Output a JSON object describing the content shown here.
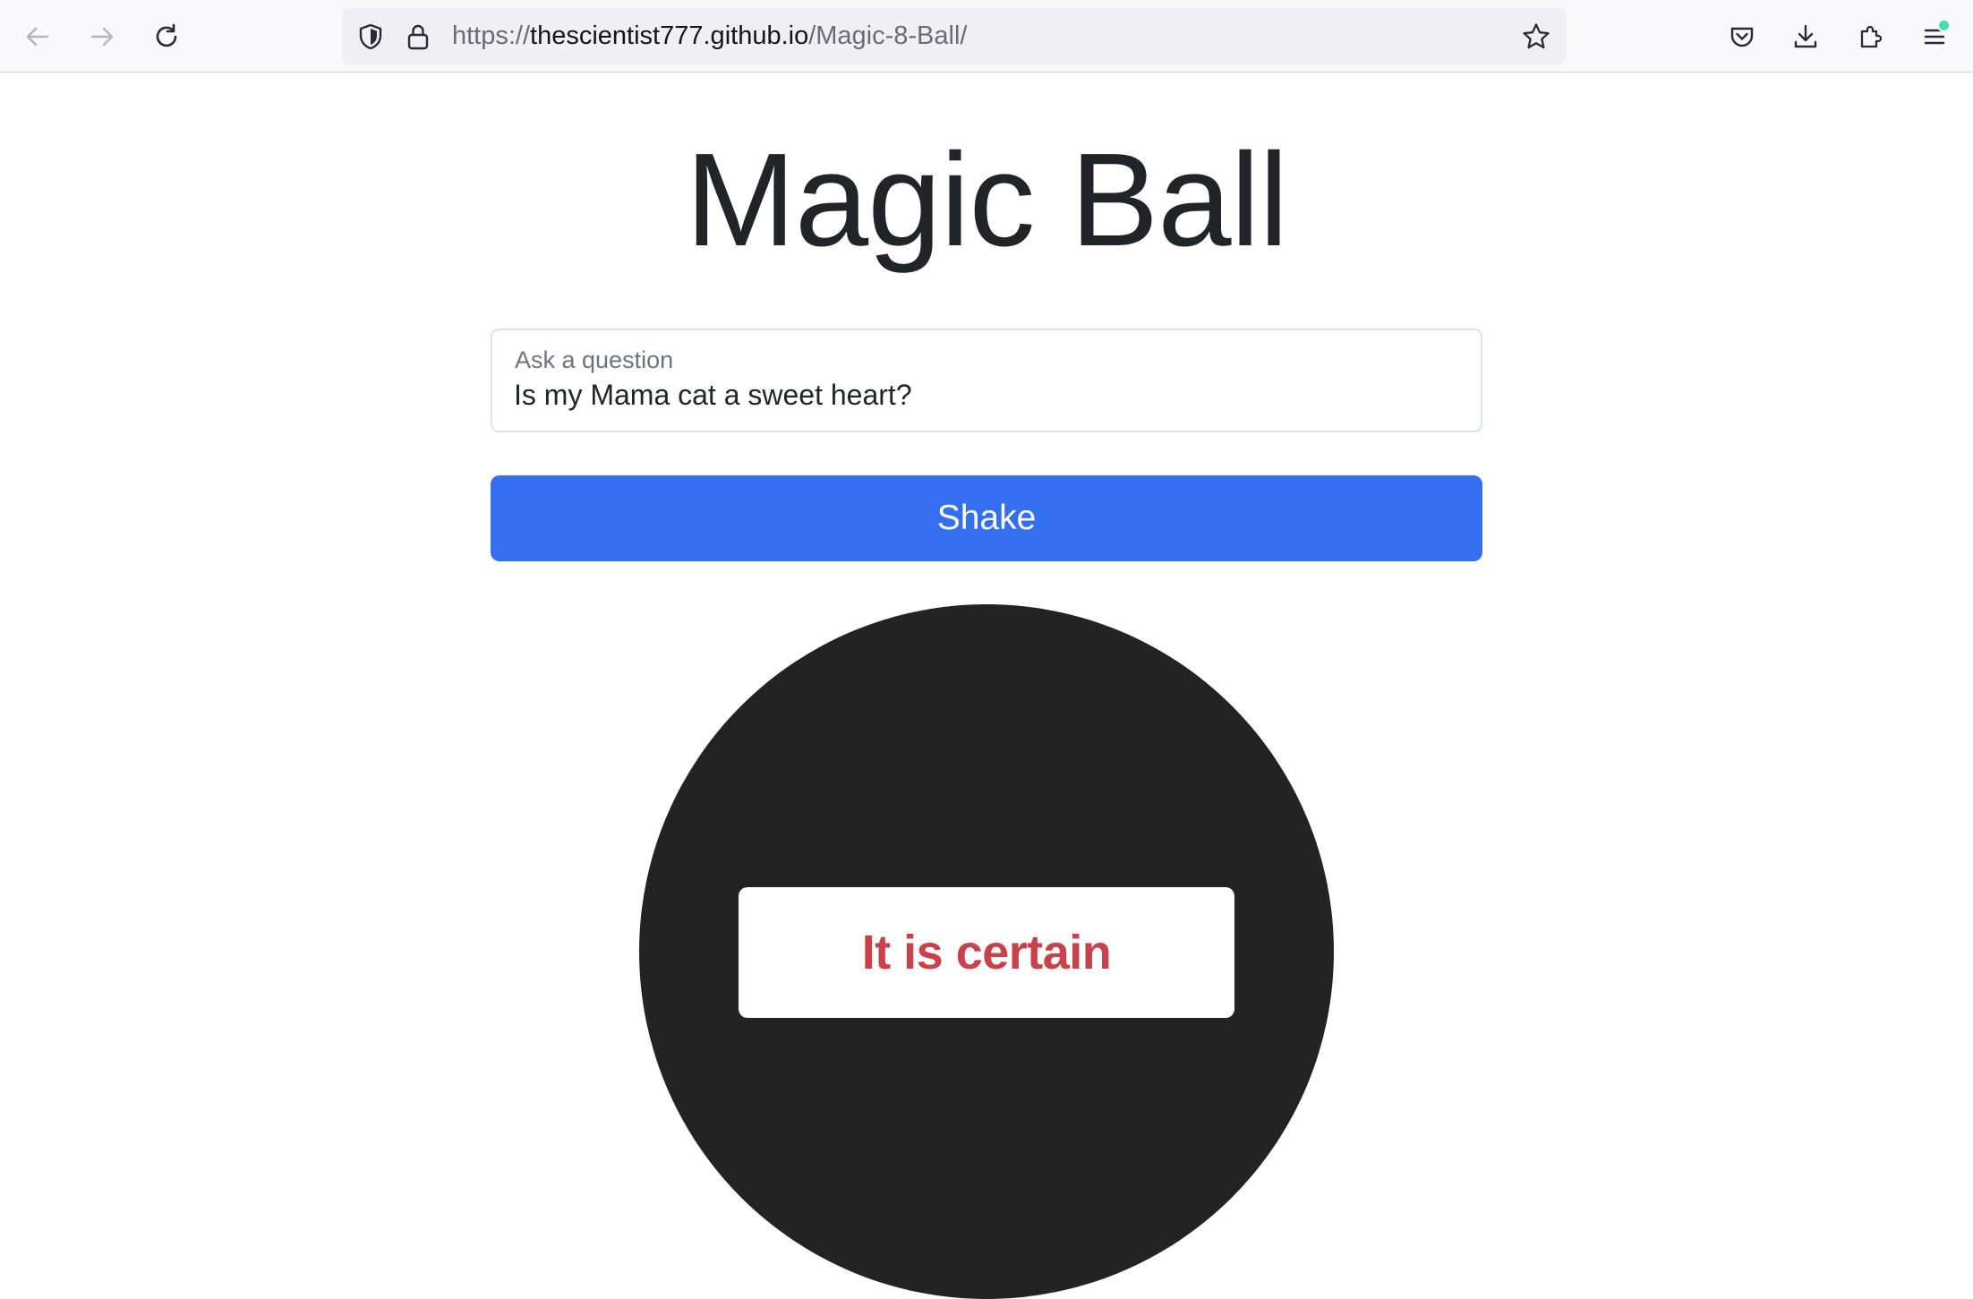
{
  "browser": {
    "url_prefix": "https://",
    "url_host": "thescientist777.github.io",
    "url_path": "/Magic-8-Ball/",
    "icons": {
      "back": "arrow-left-icon",
      "forward": "arrow-right-icon",
      "reload": "reload-icon",
      "shield": "shield-icon",
      "lock": "lock-icon",
      "bookmark": "star-icon",
      "pocket": "pocket-icon",
      "downloads": "download-icon",
      "extensions": "puzzle-icon",
      "menu": "hamburger-menu-icon"
    }
  },
  "page": {
    "title": "Magic Ball",
    "question": {
      "label": "Ask a question",
      "value": "Is my Mama cat a sweet heart?"
    },
    "shake_label": "Shake",
    "answer": "It is certain"
  },
  "colors": {
    "primary": "#346ef1",
    "ball": "#232323",
    "answer_text": "#c8414b"
  }
}
